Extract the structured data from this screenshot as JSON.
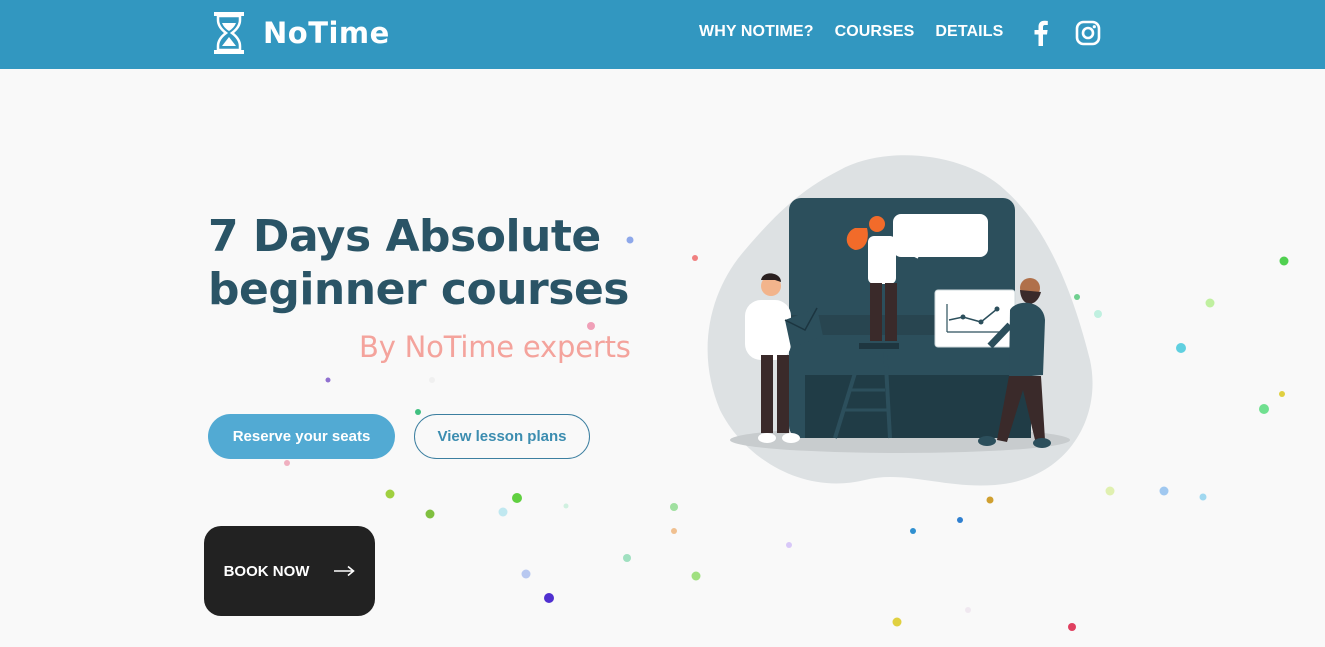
{
  "brand": {
    "name": "NoTime",
    "icon": "hourglass-icon"
  },
  "nav": {
    "links": [
      "WHY NOTIME?",
      "COURSES",
      "DETAILS"
    ],
    "social": [
      "facebook-icon",
      "instagram-icon"
    ]
  },
  "hero": {
    "title_line1": "7 Days Absolute",
    "title_line2": "beginner courses",
    "subtitle": "By NoTime experts",
    "primary_button": "Reserve your seats",
    "secondary_button": "View lesson plans",
    "book_button": "BOOK NOW",
    "book_icon": "arrow-right-icon"
  },
  "colors": {
    "header": "#3297c0",
    "title": "#2a5466",
    "subtitle": "#f4a39c",
    "primary_button": "#52aad3",
    "book_button": "#222222"
  }
}
